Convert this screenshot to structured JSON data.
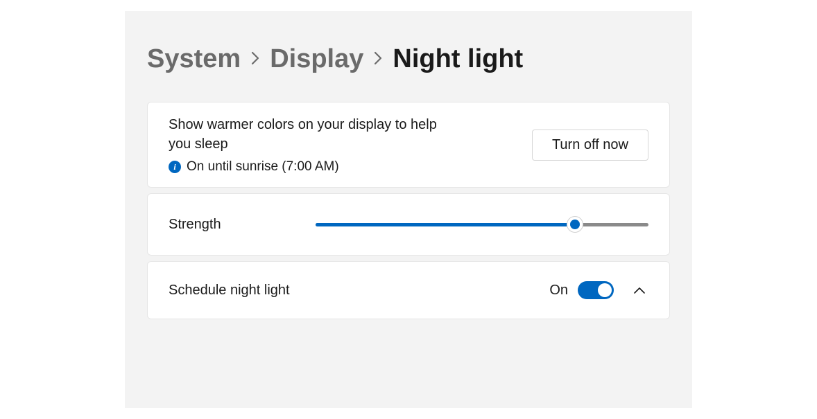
{
  "breadcrumb": {
    "items": [
      {
        "label": "System"
      },
      {
        "label": "Display"
      },
      {
        "label": "Night light"
      }
    ]
  },
  "warmer_card": {
    "description": "Show warmer colors on your display to help you sleep",
    "status": "On until sunrise (7:00 AM)",
    "action_label": "Turn off now"
  },
  "strength_card": {
    "label": "Strength",
    "value_percent": 78
  },
  "schedule_card": {
    "label": "Schedule night light",
    "state_label": "On",
    "toggle_on": true
  },
  "colors": {
    "accent": "#0067c0"
  }
}
